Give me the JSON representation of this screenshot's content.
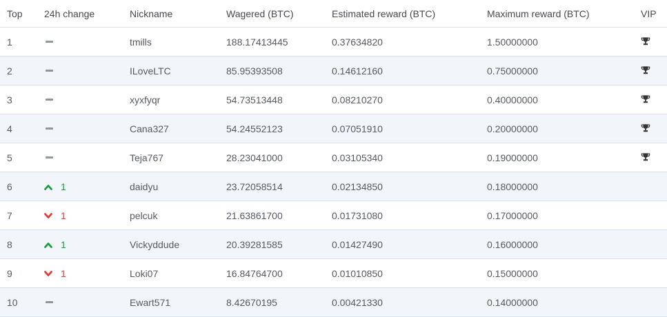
{
  "headers": {
    "top": "Top",
    "change": "24h change",
    "nickname": "Nickname",
    "wagered": "Wagered (BTC)",
    "estimated": "Estimated reward (BTC)",
    "maximum": "Maximum reward (BTC)",
    "vip": "VIP"
  },
  "colors": {
    "up": "#1a9a3a",
    "down": "#e53935",
    "dash": "#8f959c"
  },
  "rows": [
    {
      "rank": "1",
      "change": {
        "dir": "none",
        "value": ""
      },
      "nickname": "tmills",
      "wagered": "188.17413445",
      "estimated": "0.37634820",
      "maximum": "1.50000000",
      "vip": true
    },
    {
      "rank": "2",
      "change": {
        "dir": "none",
        "value": ""
      },
      "nickname": "ILoveLTC",
      "wagered": "85.95393508",
      "estimated": "0.14612160",
      "maximum": "0.75000000",
      "vip": true
    },
    {
      "rank": "3",
      "change": {
        "dir": "none",
        "value": ""
      },
      "nickname": "xyxfyqr",
      "wagered": "54.73513448",
      "estimated": "0.08210270",
      "maximum": "0.40000000",
      "vip": true
    },
    {
      "rank": "4",
      "change": {
        "dir": "none",
        "value": ""
      },
      "nickname": "Cana327",
      "wagered": "54.24552123",
      "estimated": "0.07051910",
      "maximum": "0.20000000",
      "vip": true
    },
    {
      "rank": "5",
      "change": {
        "dir": "none",
        "value": ""
      },
      "nickname": "Teja767",
      "wagered": "28.23041000",
      "estimated": "0.03105340",
      "maximum": "0.19000000",
      "vip": true
    },
    {
      "rank": "6",
      "change": {
        "dir": "up",
        "value": "1"
      },
      "nickname": "daidyu",
      "wagered": "23.72058514",
      "estimated": "0.02134850",
      "maximum": "0.18000000",
      "vip": false
    },
    {
      "rank": "7",
      "change": {
        "dir": "down",
        "value": "1"
      },
      "nickname": "pelcuk",
      "wagered": "21.63861700",
      "estimated": "0.01731080",
      "maximum": "0.17000000",
      "vip": false
    },
    {
      "rank": "8",
      "change": {
        "dir": "up",
        "value": "1"
      },
      "nickname": "Vickyddude",
      "wagered": "20.39281585",
      "estimated": "0.01427490",
      "maximum": "0.16000000",
      "vip": false
    },
    {
      "rank": "9",
      "change": {
        "dir": "down",
        "value": "1"
      },
      "nickname": "Loki07",
      "wagered": "16.84764700",
      "estimated": "0.01010850",
      "maximum": "0.15000000",
      "vip": false
    },
    {
      "rank": "10",
      "change": {
        "dir": "none",
        "value": ""
      },
      "nickname": "Ewart571",
      "wagered": "8.42670195",
      "estimated": "0.00421330",
      "maximum": "0.14000000",
      "vip": false
    }
  ]
}
